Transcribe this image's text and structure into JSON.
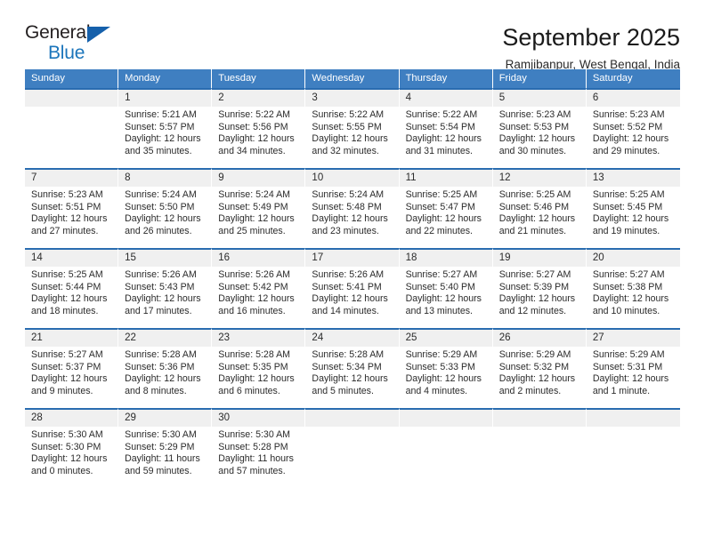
{
  "brand": {
    "name_part1": "General",
    "name_part2": "Blue",
    "triangle_color": "#1560ab",
    "blue_color": "#1b75bb"
  },
  "header": {
    "title": "September 2025",
    "location": "Ramjibanpur, West Bengal, India"
  },
  "theme": {
    "header_blue": "#3f7fc1",
    "rule_blue": "#2a6cb0",
    "daynum_background": "#f0f0f0"
  },
  "weekdays": [
    "Sunday",
    "Monday",
    "Tuesday",
    "Wednesday",
    "Thursday",
    "Friday",
    "Saturday"
  ],
  "weeks": [
    [
      {
        "day": "",
        "sunrise": "",
        "sunset": "",
        "daylight": ""
      },
      {
        "day": "1",
        "sunrise": "Sunrise: 5:21 AM",
        "sunset": "Sunset: 5:57 PM",
        "daylight": "Daylight: 12 hours and 35 minutes."
      },
      {
        "day": "2",
        "sunrise": "Sunrise: 5:22 AM",
        "sunset": "Sunset: 5:56 PM",
        "daylight": "Daylight: 12 hours and 34 minutes."
      },
      {
        "day": "3",
        "sunrise": "Sunrise: 5:22 AM",
        "sunset": "Sunset: 5:55 PM",
        "daylight": "Daylight: 12 hours and 32 minutes."
      },
      {
        "day": "4",
        "sunrise": "Sunrise: 5:22 AM",
        "sunset": "Sunset: 5:54 PM",
        "daylight": "Daylight: 12 hours and 31 minutes."
      },
      {
        "day": "5",
        "sunrise": "Sunrise: 5:23 AM",
        "sunset": "Sunset: 5:53 PM",
        "daylight": "Daylight: 12 hours and 30 minutes."
      },
      {
        "day": "6",
        "sunrise": "Sunrise: 5:23 AM",
        "sunset": "Sunset: 5:52 PM",
        "daylight": "Daylight: 12 hours and 29 minutes."
      }
    ],
    [
      {
        "day": "7",
        "sunrise": "Sunrise: 5:23 AM",
        "sunset": "Sunset: 5:51 PM",
        "daylight": "Daylight: 12 hours and 27 minutes."
      },
      {
        "day": "8",
        "sunrise": "Sunrise: 5:24 AM",
        "sunset": "Sunset: 5:50 PM",
        "daylight": "Daylight: 12 hours and 26 minutes."
      },
      {
        "day": "9",
        "sunrise": "Sunrise: 5:24 AM",
        "sunset": "Sunset: 5:49 PM",
        "daylight": "Daylight: 12 hours and 25 minutes."
      },
      {
        "day": "10",
        "sunrise": "Sunrise: 5:24 AM",
        "sunset": "Sunset: 5:48 PM",
        "daylight": "Daylight: 12 hours and 23 minutes."
      },
      {
        "day": "11",
        "sunrise": "Sunrise: 5:25 AM",
        "sunset": "Sunset: 5:47 PM",
        "daylight": "Daylight: 12 hours and 22 minutes."
      },
      {
        "day": "12",
        "sunrise": "Sunrise: 5:25 AM",
        "sunset": "Sunset: 5:46 PM",
        "daylight": "Daylight: 12 hours and 21 minutes."
      },
      {
        "day": "13",
        "sunrise": "Sunrise: 5:25 AM",
        "sunset": "Sunset: 5:45 PM",
        "daylight": "Daylight: 12 hours and 19 minutes."
      }
    ],
    [
      {
        "day": "14",
        "sunrise": "Sunrise: 5:25 AM",
        "sunset": "Sunset: 5:44 PM",
        "daylight": "Daylight: 12 hours and 18 minutes."
      },
      {
        "day": "15",
        "sunrise": "Sunrise: 5:26 AM",
        "sunset": "Sunset: 5:43 PM",
        "daylight": "Daylight: 12 hours and 17 minutes."
      },
      {
        "day": "16",
        "sunrise": "Sunrise: 5:26 AM",
        "sunset": "Sunset: 5:42 PM",
        "daylight": "Daylight: 12 hours and 16 minutes."
      },
      {
        "day": "17",
        "sunrise": "Sunrise: 5:26 AM",
        "sunset": "Sunset: 5:41 PM",
        "daylight": "Daylight: 12 hours and 14 minutes."
      },
      {
        "day": "18",
        "sunrise": "Sunrise: 5:27 AM",
        "sunset": "Sunset: 5:40 PM",
        "daylight": "Daylight: 12 hours and 13 minutes."
      },
      {
        "day": "19",
        "sunrise": "Sunrise: 5:27 AM",
        "sunset": "Sunset: 5:39 PM",
        "daylight": "Daylight: 12 hours and 12 minutes."
      },
      {
        "day": "20",
        "sunrise": "Sunrise: 5:27 AM",
        "sunset": "Sunset: 5:38 PM",
        "daylight": "Daylight: 12 hours and 10 minutes."
      }
    ],
    [
      {
        "day": "21",
        "sunrise": "Sunrise: 5:27 AM",
        "sunset": "Sunset: 5:37 PM",
        "daylight": "Daylight: 12 hours and 9 minutes."
      },
      {
        "day": "22",
        "sunrise": "Sunrise: 5:28 AM",
        "sunset": "Sunset: 5:36 PM",
        "daylight": "Daylight: 12 hours and 8 minutes."
      },
      {
        "day": "23",
        "sunrise": "Sunrise: 5:28 AM",
        "sunset": "Sunset: 5:35 PM",
        "daylight": "Daylight: 12 hours and 6 minutes."
      },
      {
        "day": "24",
        "sunrise": "Sunrise: 5:28 AM",
        "sunset": "Sunset: 5:34 PM",
        "daylight": "Daylight: 12 hours and 5 minutes."
      },
      {
        "day": "25",
        "sunrise": "Sunrise: 5:29 AM",
        "sunset": "Sunset: 5:33 PM",
        "daylight": "Daylight: 12 hours and 4 minutes."
      },
      {
        "day": "26",
        "sunrise": "Sunrise: 5:29 AM",
        "sunset": "Sunset: 5:32 PM",
        "daylight": "Daylight: 12 hours and 2 minutes."
      },
      {
        "day": "27",
        "sunrise": "Sunrise: 5:29 AM",
        "sunset": "Sunset: 5:31 PM",
        "daylight": "Daylight: 12 hours and 1 minute."
      }
    ],
    [
      {
        "day": "28",
        "sunrise": "Sunrise: 5:30 AM",
        "sunset": "Sunset: 5:30 PM",
        "daylight": "Daylight: 12 hours and 0 minutes."
      },
      {
        "day": "29",
        "sunrise": "Sunrise: 5:30 AM",
        "sunset": "Sunset: 5:29 PM",
        "daylight": "Daylight: 11 hours and 59 minutes."
      },
      {
        "day": "30",
        "sunrise": "Sunrise: 5:30 AM",
        "sunset": "Sunset: 5:28 PM",
        "daylight": "Daylight: 11 hours and 57 minutes."
      },
      {
        "day": "",
        "sunrise": "",
        "sunset": "",
        "daylight": ""
      },
      {
        "day": "",
        "sunrise": "",
        "sunset": "",
        "daylight": ""
      },
      {
        "day": "",
        "sunrise": "",
        "sunset": "",
        "daylight": ""
      },
      {
        "day": "",
        "sunrise": "",
        "sunset": "",
        "daylight": ""
      }
    ]
  ]
}
